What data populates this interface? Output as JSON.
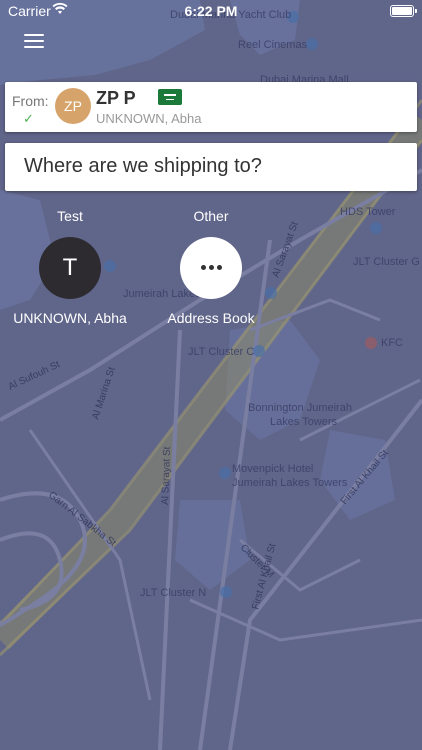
{
  "status_bar": {
    "carrier": "Carrier",
    "time": "6:22 PM"
  },
  "map_labels": {
    "dubai_marina_yacht_club": "Dubai Marina Yacht Club",
    "reel_cinemas": "Reel Cinemas",
    "dubai_marina_mall": "Dubai Marina Mall",
    "hds_tower": "HDS Tower",
    "jlt_cluster_g": "JLT Cluster G",
    "jumeirah_lakes": "Jumeirah Lakes",
    "kfc": "KFC",
    "jlt_cluster_c": "JLT Cluster C",
    "bonnington": "Bonnington Jumeirah",
    "lakes_towers": "Lakes Towers",
    "movenpick": "Movenpick Hotel",
    "movenpick2": "Jumeirah Lakes Towers",
    "al_sarayat_st": "Al Sarayat St",
    "al_sarayat_st2": "Al Sarayat St",
    "al_marina_st": "Al Marina St",
    "first_al_khail": "First Al Khail St",
    "first_al_khail2": "First Al Khail St",
    "garn_al_sabkha": "Garn Al Sabkha St",
    "jlt_cluster_n": "JLT Cluster N",
    "cluster_m": "Cluster M",
    "al_sufouh": "Al Sufouh St"
  },
  "from_card": {
    "label": "From:",
    "initials": "ZP",
    "name": "ZP P",
    "address": "UNKNOWN, Abha",
    "check": "✓"
  },
  "to_card": {
    "prompt": "Where are we shipping to?"
  },
  "options": [
    {
      "top_label": "Test",
      "initial": "T",
      "bottom_label": "UNKNOWN, Abha"
    },
    {
      "top_label": "Other",
      "bottom_label": "Address Book"
    }
  ],
  "colors": {
    "overlay": "#5f6488",
    "avatar": "#d6a36a",
    "dark_circle": "#2d2a30",
    "flag": "#1b7a3a"
  }
}
